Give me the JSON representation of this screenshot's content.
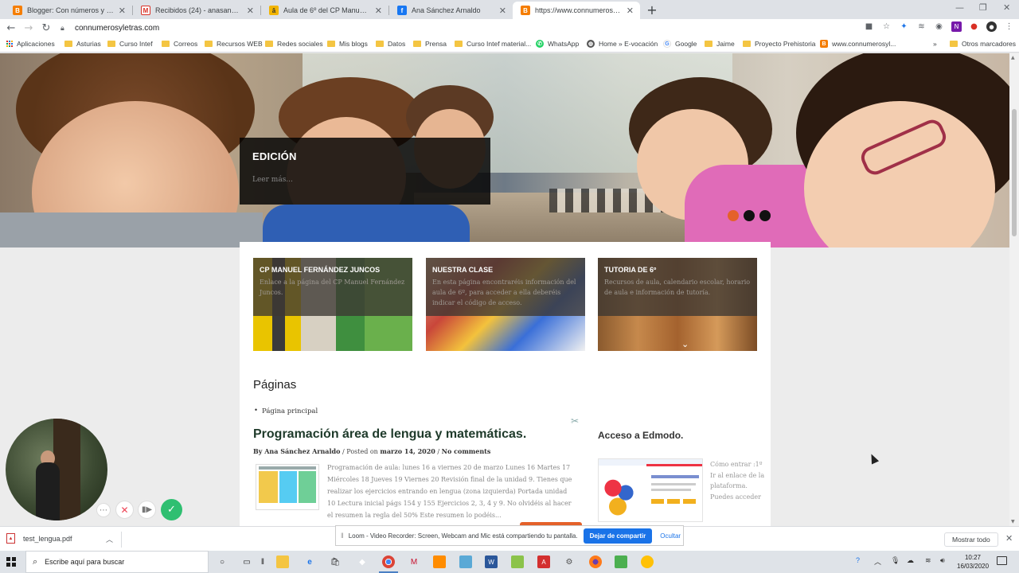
{
  "browser": {
    "tabs": [
      {
        "title": "Blogger: Con números y letras. -",
        "favicon": "blogger-icon",
        "color": "#f57d00"
      },
      {
        "title": "Recibidos (24) - anasanchezarnal",
        "favicon": "gmail-icon",
        "color": "#d93025"
      },
      {
        "title": "Aula de 6º del CP Manuel Fernán",
        "favicon": "blackboard-icon",
        "color": "#f2b400"
      },
      {
        "title": "Ana Sánchez Arnaldo",
        "favicon": "facebook-icon",
        "color": "#1877f2"
      },
      {
        "title": "https://www.connumerosyletras.",
        "favicon": "blogger-icon",
        "color": "#f57d00",
        "active": true
      }
    ],
    "address": "connumerosyletras.com",
    "bookmarks": [
      "Aplicaciones",
      "Asturias",
      "Curso Intef",
      "Correos",
      "Recursos WEB",
      "Redes sociales",
      "Mis blogs",
      "Datos",
      "Prensa",
      "Curso Intef material...",
      "WhatsApp",
      "Home » E-vocación",
      "Google",
      "Jaime",
      "Proyecto Prehistoria",
      "www.connumerosyl...",
      "»",
      "Otros marcadores"
    ]
  },
  "page": {
    "slider": {
      "caption_title": "EDICIÓN",
      "caption_link": "Leer más...",
      "dots": 3,
      "active_dot": 1
    },
    "features": [
      {
        "title": "CP MANUEL FERNÁNDEZ JUNCOS",
        "desc": "Enlace a la página del CP Manuel Fernández Juncos."
      },
      {
        "title": "NUESTRA CLASE",
        "desc": "En esta página encontraréis información del aula de 6º, para acceder a ella deberéis indicar el código de acceso."
      },
      {
        "title": "TUTORIA DE 6º",
        "desc": "Recursos de aula, calendario escolar, horario de aula e información de tutoría."
      }
    ],
    "pages_heading": "Páginas",
    "pages_items": [
      "Página principal"
    ],
    "post": {
      "title": "Programación área de lengua y matemáticas.",
      "author": "By Ana Sánchez Arnaldo",
      "sep1": "/",
      "posted": "Posted on",
      "date": "marzo 14, 2020",
      "sep2": "/",
      "comments": "No comments",
      "excerpt": "Programación de aula: lunes 16 a viernes 20 de marzo     Lunes 16 Martes 17 Miércoles 18 Jueves 19 Viernes 20 Revisión final de la unidad 9. Tienes que realizar los ejercicios entrando en lengua (zona izquierda) Portada unidad 10 Lectura inicial págs 154 y 155 Ejercicios 2, 3, 4 y 9. No olvidéis al hacer el resumen la regla del 50% Este resumen lo podéis..."
    },
    "sidebar": {
      "title": "Acceso a Edmodo.",
      "text": "Cómo entrar  :1º Ir al enlace de la plataforma. Puedes acceder"
    }
  },
  "loom": {
    "share_message": "Loom - Video Recorder: Screen, Webcam and Mic está compartiendo tu pantalla.",
    "stop_sharing": "Dejar de compartir",
    "hide": "Ocultar"
  },
  "downloads": {
    "file": "test_lengua.pdf",
    "show_all": "Mostrar todo"
  },
  "taskbar": {
    "search_placeholder": "Escribe aquí para buscar",
    "time": "10:27",
    "date": "16/03/2020"
  }
}
